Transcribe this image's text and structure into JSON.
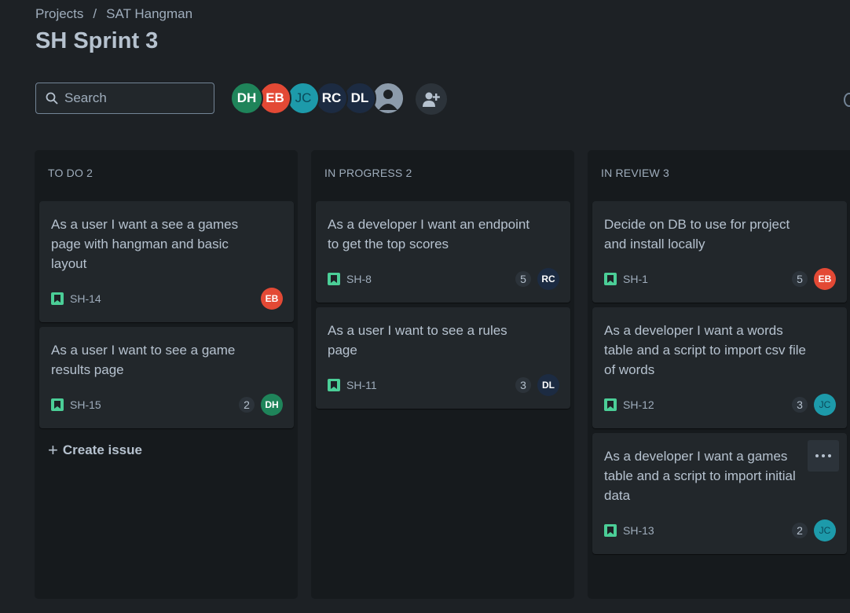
{
  "breadcrumb": {
    "projects": "Projects",
    "separator": "/",
    "project": "SAT Hangman"
  },
  "title": "SH Sprint 3",
  "search": {
    "placeholder": "Search"
  },
  "people": [
    {
      "initials": "DH",
      "color": "#1f845a"
    },
    {
      "initials": "EB",
      "color": "#e34935"
    },
    {
      "initials": "JC",
      "color": "#1d9aaa"
    },
    {
      "initials": "RC",
      "color": "#1c2b42"
    },
    {
      "initials": "DL",
      "color": "#1c2b42"
    },
    {
      "initials": "",
      "icon": "user-icon"
    }
  ],
  "colors": {
    "story": "#4bce97",
    "background": "#1d2125",
    "column": "#161a1d",
    "card": "#22272b"
  },
  "columns": [
    {
      "title": "TO DO 2",
      "cards": [
        {
          "title": "As a user I want a see a games page with hangman and basic layout",
          "key": "SH-14",
          "points": "",
          "assignee": "EB"
        },
        {
          "title": "As a user I want to see a game results page",
          "key": "SH-15",
          "points": "2",
          "assignee": "DH"
        }
      ],
      "create_issue": "Create issue"
    },
    {
      "title": "IN PROGRESS 2",
      "cards": [
        {
          "title": "As a developer I want an endpoint to get the top scores",
          "key": "SH-8",
          "points": "5",
          "assignee": "RC"
        },
        {
          "title": "As a user I want to see a rules page",
          "key": "SH-11",
          "points": "3",
          "assignee": "DL"
        }
      ]
    },
    {
      "title": "IN REVIEW 3",
      "cards": [
        {
          "title": "Decide on DB to use for project and install locally",
          "key": "SH-1",
          "points": "5",
          "assignee": "EB"
        },
        {
          "title": "As a developer I want a words table and a script to import csv file of words",
          "key": "SH-12",
          "points": "3",
          "assignee": "JC"
        },
        {
          "title": "As a developer I want a games table and a script to import initial data",
          "key": "SH-13",
          "points": "2",
          "assignee": "JC"
        }
      ]
    }
  ]
}
